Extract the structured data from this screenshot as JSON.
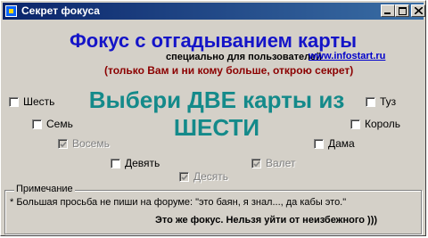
{
  "window": {
    "title": "Секрет фокуса"
  },
  "header": {
    "title": "Фокус с отгадыванием карты",
    "subtitle": "специально для пользователей",
    "link": "www.infostart.ru",
    "promise": "(только Вам и ни кому больше, открою секрет)"
  },
  "instruction": {
    "line1": "Выбери ДВЕ карты из",
    "line2": "ШЕСТИ"
  },
  "cards": [
    {
      "label": "Шесть",
      "checked": false,
      "enabled": true
    },
    {
      "label": "Семь",
      "checked": false,
      "enabled": true
    },
    {
      "label": "Восемь",
      "checked": true,
      "enabled": false
    },
    {
      "label": "Девять",
      "checked": false,
      "enabled": true
    },
    {
      "label": "Десять",
      "checked": true,
      "enabled": false
    },
    {
      "label": "Валет",
      "checked": true,
      "enabled": false
    },
    {
      "label": "Дама",
      "checked": false,
      "enabled": true
    },
    {
      "label": "Король",
      "checked": false,
      "enabled": true
    },
    {
      "label": "Туз",
      "checked": false,
      "enabled": true
    }
  ],
  "notes": {
    "group_title": "Примечание",
    "text": "* Большая просьба не пиши на форуме: \"это баян, я знал..., да кабы это.\"",
    "footer": "Это же фокус. Нельзя уйти от неизбежного )))"
  },
  "colors": {
    "title_blue": "#1414c8",
    "teal": "#148a8a",
    "dark_red": "#8b0000",
    "link": "#0000cc"
  },
  "icons": {
    "app": "app-icon",
    "minimize": "minimize-icon",
    "maximize": "maximize-icon",
    "close": "close-icon",
    "check": "checkmark-icon"
  }
}
